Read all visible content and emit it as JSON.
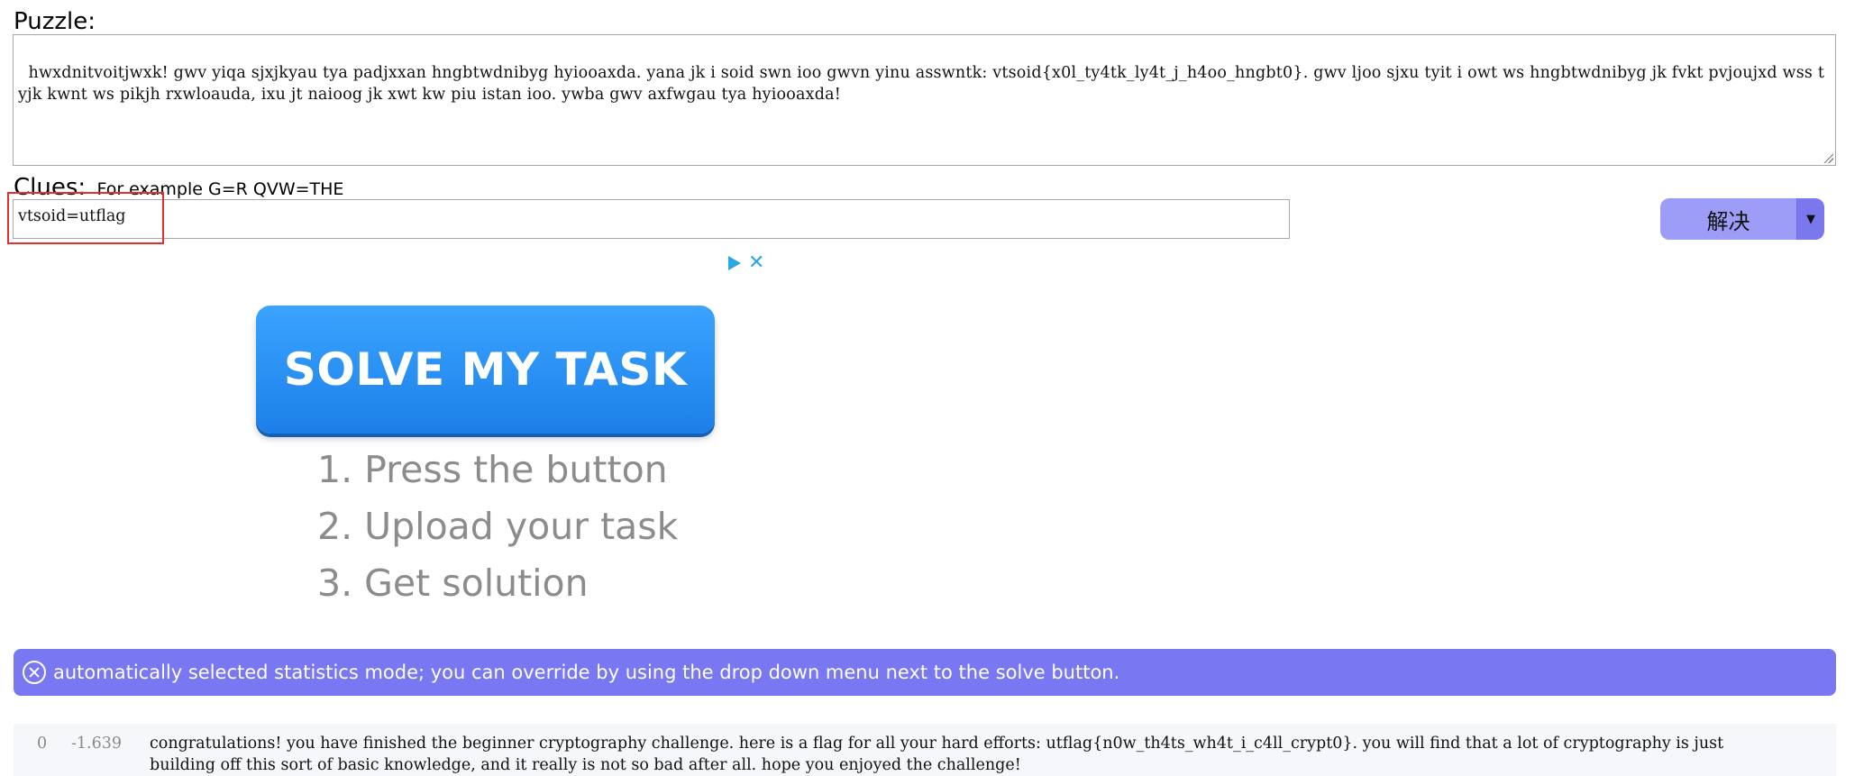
{
  "puzzle": {
    "label": "Puzzle:",
    "text": "hwxdnitvoitjwxk! gwv yiqa sjxjkyau tya padjxxan hngbtwdnibyg hyiooaxda. yana jk i soid swn ioo gwvn yinu asswntk: vtsoid{x0l_ty4tk_ly4t_j_h4oo_hngbt0}. gwv ljoo sjxu tyit i owt ws hngbtwdnibyg jk fvkt pvjoujxd wss tyjk kwnt ws pikjh rxwloauda, ixu jt naioog jk xwt kw piu istan ioo. ywba gwv axfwgau tya hyiooaxda!"
  },
  "clues": {
    "label": "Clues:",
    "hint": "For example G=R QVW=THE",
    "value": "vtsoid=utflag"
  },
  "solve": {
    "label": "解决",
    "dropdown_glyph": "▼"
  },
  "ad": {
    "close_glyph": "✕",
    "button_text": "SOLVE MY TASK",
    "steps": [
      "1. Press the button",
      "2. Upload your task",
      "3. Get solution"
    ]
  },
  "notice": {
    "text": "automatically selected statistics mode; you can override by using the drop down menu next to the solve button."
  },
  "results": [
    {
      "index": "0",
      "score": "-1.639",
      "text": "congratulations! you have finished the beginner cryptography challenge. here is a flag for all your hard efforts: utflag{n0w_th4ts_wh4t_i_c4ll_crypt0}. you will find that a lot of cryptography is just building off this sort of basic knowledge, and it really is not so bad after all. hope you enjoyed the challenge!"
    }
  ]
}
